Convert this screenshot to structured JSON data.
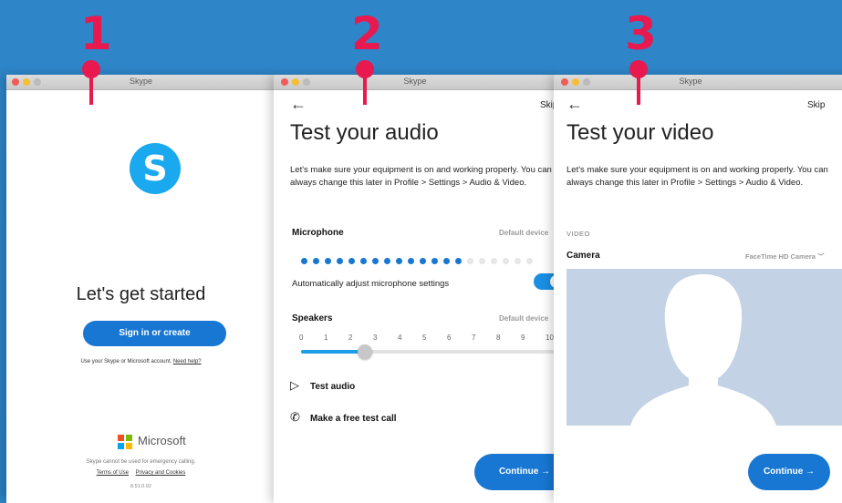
{
  "steps": [
    "1",
    "2",
    "3"
  ],
  "windows": {
    "w1": {
      "title": "Skype",
      "logo_letter": "S",
      "heading": "Let's get started",
      "sign_in_label": "Sign in or create",
      "account_note": "Use your Skype or Microsoft account.",
      "need_help": "Need help?",
      "brand": "Microsoft",
      "emergency_note": "Skype cannot be used for emergency calling.",
      "terms": "Terms of Use",
      "privacy": "Privacy and Cookies",
      "version": "8.51.0.92"
    },
    "w2": {
      "title": "Skype",
      "back": "←",
      "skip": "Skip",
      "heading": "Test your audio",
      "paragraph": "Let's make sure your equipment is on and working properly. You can always change this later in Profile > Settings > Audio & Video.",
      "microphone_label": "Microphone",
      "microphone_device": "Default device",
      "mic_level": 0.72,
      "auto_adjust_label": "Automatically adjust microphone settings",
      "auto_adjust_on": true,
      "speakers_label": "Speakers",
      "speakers_device": "Default device",
      "speaker_ticks": [
        "0",
        "1",
        "2",
        "3",
        "4",
        "5",
        "6",
        "7",
        "8",
        "9",
        "10"
      ],
      "speaker_volume": 2.5,
      "test_audio_label": "Test audio",
      "free_call_label": "Make a free test call",
      "continue_label": "Continue →"
    },
    "w3": {
      "title": "Skype",
      "back": "←",
      "skip": "Skip",
      "heading": "Test your video",
      "paragraph": "Let's make sure your equipment is on and working properly. You can always change this later in Profile > Settings > Audio & Video.",
      "video_section": "VIDEO",
      "camera_label": "Camera",
      "camera_device": "FaceTime HD Camera",
      "continue_label": "Continue →"
    }
  },
  "colors": {
    "background": "#2e86c9",
    "accent_red": "#e8194e",
    "skype_blue": "#1aa8ef",
    "button_blue": "#1877d2",
    "preview_bg": "#c3d2e4"
  }
}
